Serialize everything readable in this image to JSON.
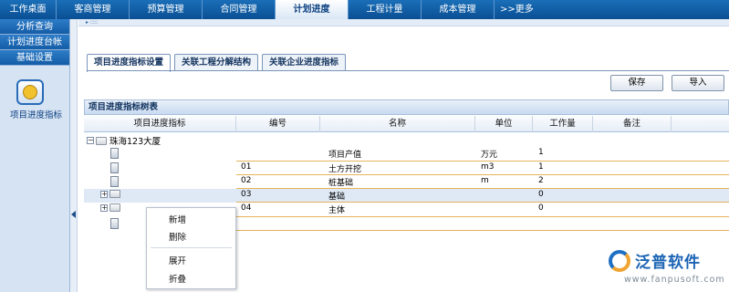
{
  "topnav": {
    "tabs": [
      "工作桌面",
      "客商管理",
      "预算管理",
      "合同管理",
      "计划进度",
      "工程计量",
      "成本管理"
    ],
    "active_index": 4,
    "more": ">>更多"
  },
  "sidebar": {
    "items": [
      "分析查询",
      "计划进度台帐",
      "基础设置"
    ],
    "selected_module": "项目进度指标"
  },
  "tabs": [
    "项目进度指标设置",
    "关联工程分解结构",
    "关联企业进度指标"
  ],
  "buttons": {
    "save": "保存",
    "import": "导入"
  },
  "panel_title": "项目进度指标树表",
  "columns": [
    "项目进度指标",
    "编号",
    "名称",
    "单位",
    "工作量",
    "备注"
  ],
  "tree": {
    "root": "珠海123大厦",
    "rows": [
      {
        "code": "",
        "name": "项目产值",
        "unit": "万元",
        "qty": "1"
      },
      {
        "code": "01",
        "name": "土方开挖",
        "unit": "m3",
        "qty": "1"
      },
      {
        "code": "02",
        "name": "桩基础",
        "unit": "m",
        "qty": "2"
      },
      {
        "code": "03",
        "name": "基础",
        "unit": "",
        "qty": "0"
      },
      {
        "code": "04",
        "name": "主体",
        "unit": "",
        "qty": "0"
      },
      {
        "code": "",
        "name": "",
        "unit": "",
        "qty": ""
      }
    ]
  },
  "context_menu": [
    "新增",
    "删除",
    "展开",
    "折叠"
  ],
  "logo": {
    "name": "泛普软件",
    "url": "www.fanpusoft.com"
  },
  "colors": {
    "nav": "#0a4f94",
    "accent": "#e6b35b",
    "selection": "#dfe8f5"
  }
}
